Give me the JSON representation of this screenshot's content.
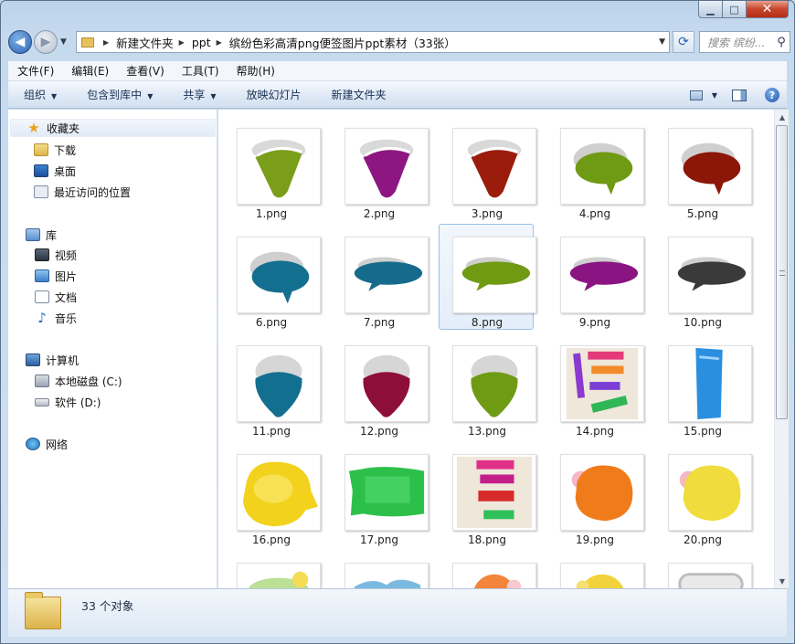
{
  "window": {
    "caption": {
      "minimize": "▁",
      "maximize": "□",
      "close": "✕"
    }
  },
  "nav": {
    "back_glyph": "◀",
    "forward_glyph": "▶",
    "breadcrumb": [
      "新建文件夹",
      "ppt",
      "缤纷色彩高清png便签图片ppt素材（33张）"
    ],
    "refresh_glyph": "⟳",
    "search_placeholder": "搜索 缤纷...",
    "search_glyph": "⚲"
  },
  "menu": [
    "文件(F)",
    "编辑(E)",
    "查看(V)",
    "工具(T)",
    "帮助(H)"
  ],
  "commands": [
    {
      "label": "组织",
      "dropdown": true
    },
    {
      "label": "包含到库中",
      "dropdown": true
    },
    {
      "label": "共享",
      "dropdown": true
    },
    {
      "label": "放映幻灯片",
      "dropdown": false
    },
    {
      "label": "新建文件夹",
      "dropdown": false
    }
  ],
  "sidebar": {
    "favorites": {
      "label": "收藏夹",
      "items": [
        "下载",
        "桌面",
        "最近访问的位置"
      ]
    },
    "libraries": {
      "label": "库",
      "items": [
        "视频",
        "图片",
        "文档",
        "音乐"
      ]
    },
    "computer": {
      "label": "计算机",
      "items": [
        "本地磁盘 (C:)",
        "软件 (D:)"
      ]
    },
    "network": {
      "label": "网络"
    }
  },
  "files": [
    {
      "name": "1.png",
      "kind": "triangle",
      "color": "#7a9e1a"
    },
    {
      "name": "2.png",
      "kind": "triangle",
      "color": "#8e1682"
    },
    {
      "name": "3.png",
      "kind": "triangle",
      "color": "#9c1c0c"
    },
    {
      "name": "4.png",
      "kind": "bubble",
      "color": "#6f9a14"
    },
    {
      "name": "5.png",
      "kind": "bubble",
      "color": "#8c1608"
    },
    {
      "name": "6.png",
      "kind": "bubble",
      "color": "#136f8f"
    },
    {
      "name": "7.png",
      "kind": "wide-bubble",
      "color": "#166b8c"
    },
    {
      "name": "8.png",
      "kind": "wide-bubble",
      "color": "#6f9a12"
    },
    {
      "name": "9.png",
      "kind": "wide-bubble",
      "color": "#8a1482"
    },
    {
      "name": "10.png",
      "kind": "wide-bubble",
      "color": "#3a3a3a"
    },
    {
      "name": "11.png",
      "kind": "drop",
      "color": "#136f8f"
    },
    {
      "name": "12.png",
      "kind": "drop",
      "color": "#8e0e3a"
    },
    {
      "name": "13.png",
      "kind": "drop",
      "color": "#6f9a14"
    },
    {
      "name": "14.png",
      "kind": "sticky-strips",
      "color": "#e53a7a"
    },
    {
      "name": "15.png",
      "kind": "blue-strip",
      "color": "#2b8fe0"
    },
    {
      "name": "16.png",
      "kind": "splat",
      "color": "#f2d21c"
    },
    {
      "name": "17.png",
      "kind": "paper",
      "color": "#2cc04a"
    },
    {
      "name": "18.png",
      "kind": "sticky-strips-2",
      "color": "#e0308a"
    },
    {
      "name": "19.png",
      "kind": "blob",
      "color": "#f07b1a"
    },
    {
      "name": "20.png",
      "kind": "blob",
      "color": "#f0dc3c"
    },
    {
      "name": "",
      "kind": "partial-green",
      "color": "#9ed36a"
    },
    {
      "name": "",
      "kind": "partial-blue",
      "color": "#5aa9d8"
    },
    {
      "name": "",
      "kind": "partial-orange",
      "color": "#f2853a"
    },
    {
      "name": "",
      "kind": "partial-yellow",
      "color": "#f2d23c"
    },
    {
      "name": "",
      "kind": "partial-gray",
      "color": "#bcbcbc"
    }
  ],
  "selected_index": 7,
  "status": {
    "count_text": "33 个对象"
  }
}
